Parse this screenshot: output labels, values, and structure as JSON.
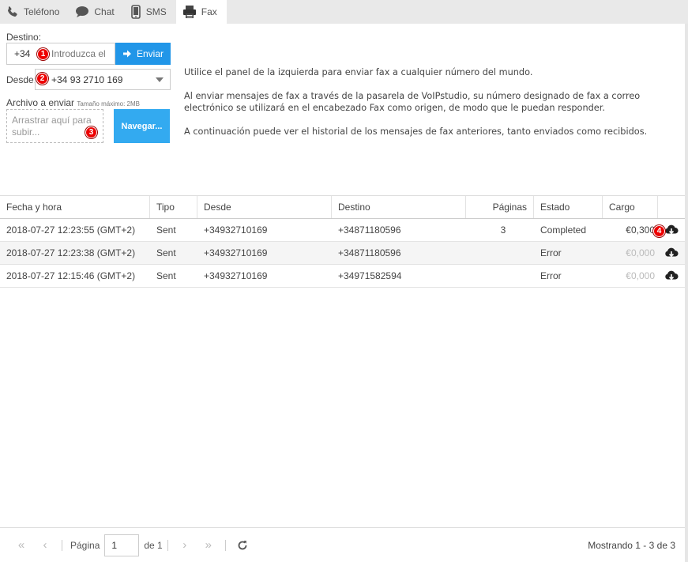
{
  "tabs": [
    {
      "label": "Teléfono",
      "icon": "phone-icon"
    },
    {
      "label": "Chat",
      "icon": "chat-bubble-icon"
    },
    {
      "label": "SMS",
      "icon": "mobile-phone-icon"
    },
    {
      "label": "Fax",
      "icon": "fax-icon",
      "active": true
    }
  ],
  "form": {
    "destino_label": "Destino:",
    "prefix": "+34",
    "dest_placeholder": "Introduzca el",
    "send_label": "Enviar",
    "desde_label": "Desde:",
    "desde_value": "+34 93 2710 169",
    "archivo_label": "Archivo a enviar",
    "archivo_size": "Tamaño máximo: 2MB",
    "dropzone_text": "Arrastrar aquí para subir...",
    "browse_label": "Navegar..."
  },
  "badges": [
    "1",
    "2",
    "3",
    "4"
  ],
  "info": [
    "Utilice el panel de la izquierda para enviar fax a cualquier número del mundo.",
    "Al enviar mensajes de fax a través de la pasarela de VoIPstudio, su número designado de fax a correo electrónico se utilizará en el encabezado Fax como origen, de modo que le puedan responder.",
    "A continuación puede ver el historial de los mensajes de fax anteriores, tanto enviados como recibidos."
  ],
  "table": {
    "columns": [
      "Fecha y hora",
      "Tipo",
      "Desde",
      "Destino",
      "Páginas",
      "Estado",
      "Cargo",
      ""
    ],
    "rows": [
      {
        "fecha": "2018-07-27 12:23:55 (GMT+2)",
        "tipo": "Sent",
        "desde": "+34932710169",
        "destino": "+34871180596",
        "paginas": "3",
        "estado": "Completed",
        "cargo": "€0,300"
      },
      {
        "fecha": "2018-07-27 12:23:38 (GMT+2)",
        "tipo": "Sent",
        "desde": "+34932710169",
        "destino": "+34871180596",
        "paginas": "",
        "estado": "Error",
        "cargo": "€0,000"
      },
      {
        "fecha": "2018-07-27 12:15:46 (GMT+2)",
        "tipo": "Sent",
        "desde": "+34932710169",
        "destino": "+34971582594",
        "paginas": "",
        "estado": "Error",
        "cargo": "€0,000"
      }
    ]
  },
  "pager": {
    "page_label": "Página",
    "page_value": "1",
    "of_label": "de 1",
    "status": "Mostrando 1 - 3 de 3"
  },
  "colors": {
    "accent": "#2196e8",
    "browse": "#33aaf0",
    "badge": "#e00000"
  }
}
